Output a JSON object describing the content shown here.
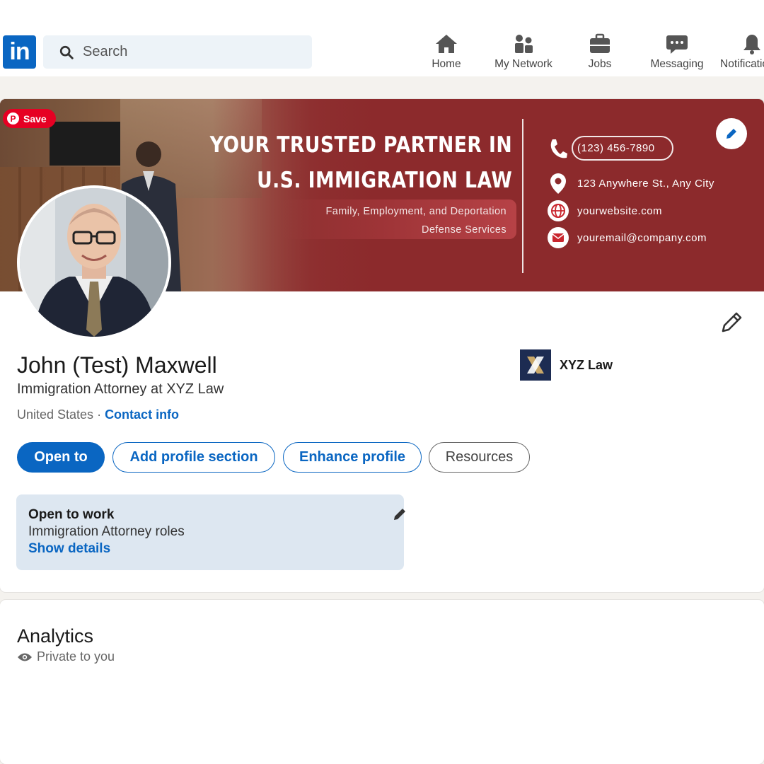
{
  "nav": {
    "logo": "in",
    "search_placeholder": "Search",
    "items": [
      {
        "label": "Home",
        "icon": "home-icon"
      },
      {
        "label": "My Network",
        "icon": "network-icon"
      },
      {
        "label": "Jobs",
        "icon": "briefcase-icon"
      },
      {
        "label": "Messaging",
        "icon": "messaging-icon"
      },
      {
        "label": "Notifications",
        "icon": "bell-icon"
      }
    ]
  },
  "banner": {
    "pinterest_save": "Save",
    "headline_line1": "YOUR TRUSTED PARTNER IN",
    "headline_line2": "U.S. IMMIGRATION LAW",
    "sub_line1": "Family, Employment, and Deportation",
    "sub_line2": "Defense Services",
    "phone": "(123) 456-7890",
    "address": "123 Anywhere St., Any City",
    "website": "yourwebsite.com",
    "email": "youremail@company.com"
  },
  "profile": {
    "name": "John (Test) Maxwell",
    "headline": "Immigration Attorney at XYZ Law",
    "location": "United States",
    "separator": " · ",
    "contact_link": "Contact info",
    "company": "XYZ Law"
  },
  "actions": {
    "open_to": "Open to",
    "add_section": "Add profile section",
    "enhance": "Enhance profile",
    "resources": "Resources"
  },
  "open_to_work": {
    "title": "Open to work",
    "roles": "Immigration Attorney roles",
    "details_link": "Show details"
  },
  "analytics": {
    "title": "Analytics",
    "visibility": "Private to you"
  },
  "colors": {
    "brand": "#0a66c2",
    "banner": "#8c2a2c",
    "open_to_work_bg": "#dde7f1",
    "pinterest": "#e60023"
  }
}
